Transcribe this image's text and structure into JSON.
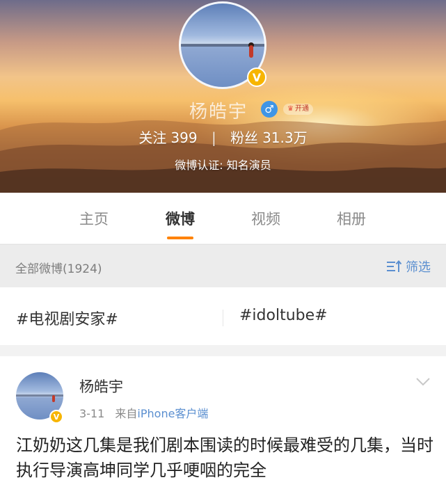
{
  "profile": {
    "name": "杨皓宇",
    "gender_icon": "male-icon",
    "member_badge": "开通",
    "following_label": "关注",
    "following_count": "399",
    "fans_label": "粉丝",
    "fans_count": "31.3万",
    "separator": "|",
    "verification": "微博认证: 知名演员",
    "verified_badge": "V"
  },
  "tabs": [
    {
      "label": "主页",
      "active": false
    },
    {
      "label": "微博",
      "active": true
    },
    {
      "label": "视频",
      "active": false
    },
    {
      "label": "相册",
      "active": false
    }
  ],
  "filter": {
    "title": "全部微博(1924)",
    "button_label": "筛选"
  },
  "topics": [
    {
      "label": "#电视剧安家#"
    },
    {
      "label": "#idoltube#"
    }
  ],
  "post": {
    "author": "杨皓宇",
    "time": "3-11",
    "source_prefix": "来自",
    "source": "iPhone客户端",
    "verified_badge": "V",
    "body": "江奶奶这几集是我们剧本围读的时候最难受的几集，当时执行导演高坤同学几乎哽咽的完全"
  },
  "colors": {
    "accent": "#ff8200",
    "link": "#5b8fd0",
    "verified": "#f7b500",
    "gender": "#3f95e6"
  }
}
